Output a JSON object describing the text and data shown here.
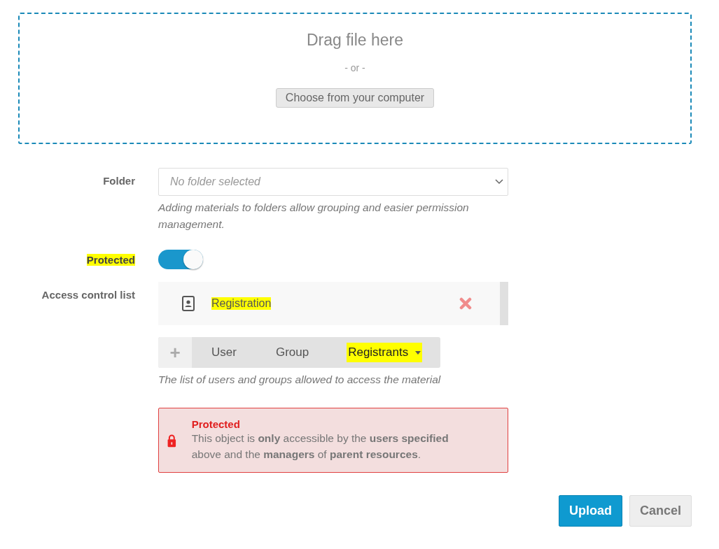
{
  "dropzone": {
    "title": "Drag file here",
    "separator": "- or -",
    "button": "Choose from your computer"
  },
  "folder": {
    "label": "Folder",
    "placeholder": "No folder selected",
    "help": "Adding materials to folders allow grouping and easier permission management."
  },
  "protected": {
    "label": "Protected",
    "highlighted": true,
    "on": true
  },
  "acl": {
    "label": "Access control list",
    "items": [
      {
        "name": "Registration",
        "highlighted": true
      }
    ],
    "add_icon": "+",
    "tabs": [
      {
        "label": "User",
        "highlighted": false,
        "dropdown": false
      },
      {
        "label": "Group",
        "highlighted": false,
        "dropdown": false
      },
      {
        "label": "Registrants",
        "highlighted": true,
        "dropdown": true
      }
    ],
    "help": "The list of users and groups allowed to access the material"
  },
  "alert": {
    "title": "Protected",
    "text": "This object is **only** accessible by the **users specified** above and the **managers** of **parent resources**."
  },
  "buttons": [
    {
      "label": "Upload",
      "kind": "primary"
    },
    {
      "label": "Cancel",
      "kind": "secondary"
    }
  ]
}
